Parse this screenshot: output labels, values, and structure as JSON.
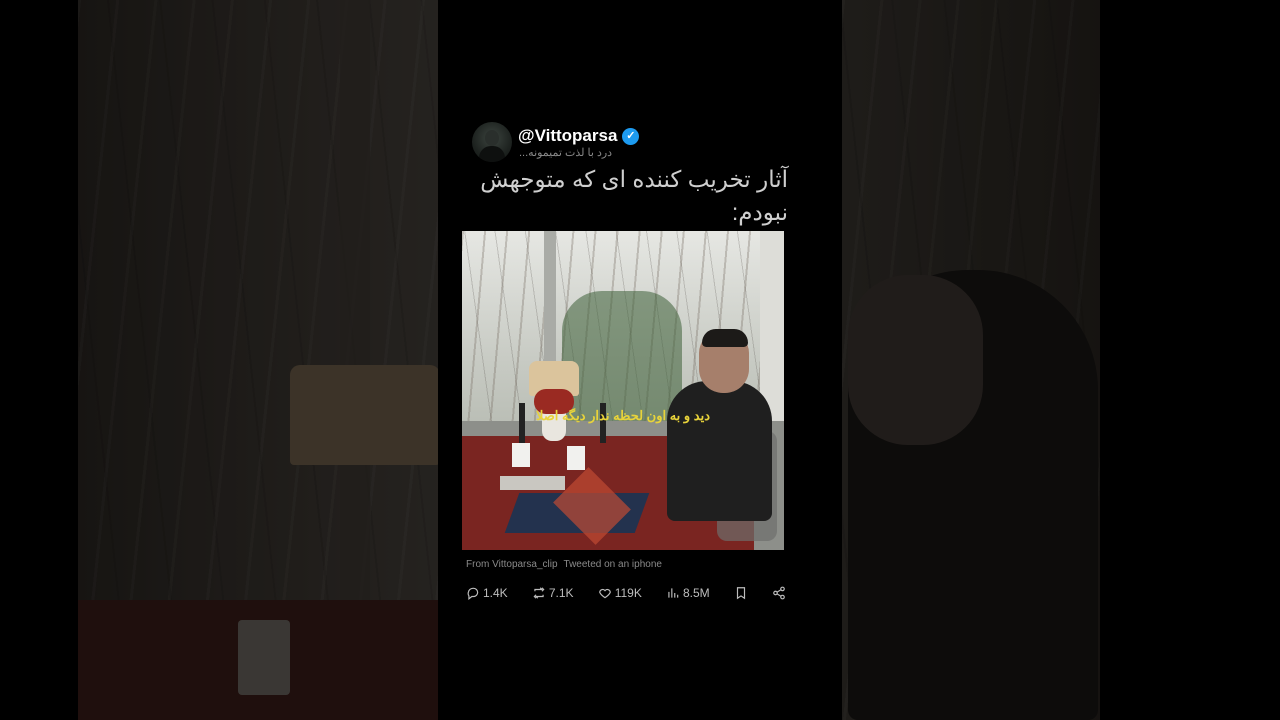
{
  "tweet": {
    "handle": "@Vittoparsa",
    "verified_icon": "verified-badge-icon",
    "bio": "درد با لذت تمیمونه...",
    "text": "آثار تخریب کننده ای که متوجهش نبودم:",
    "media_caption": "دید و به اون لحظه ندار دیگه اصلا",
    "source": "From Vittoparsa_clip",
    "client": "Tweeted on an iphone"
  },
  "background": {
    "caption": "دیگه اصلا"
  },
  "actions": {
    "replies": "1.4K",
    "retweets": "7.1K",
    "likes": "119K",
    "views": "8.5M",
    "reply_icon": "reply-icon",
    "retweet_icon": "retweet-icon",
    "like_icon": "heart-icon",
    "views_icon": "bar-chart-icon",
    "bookmark_icon": "bookmark-icon",
    "share_icon": "share-icon"
  },
  "colors": {
    "verified": "#1d9bf0",
    "caption_yellow": "#e8d33a"
  }
}
